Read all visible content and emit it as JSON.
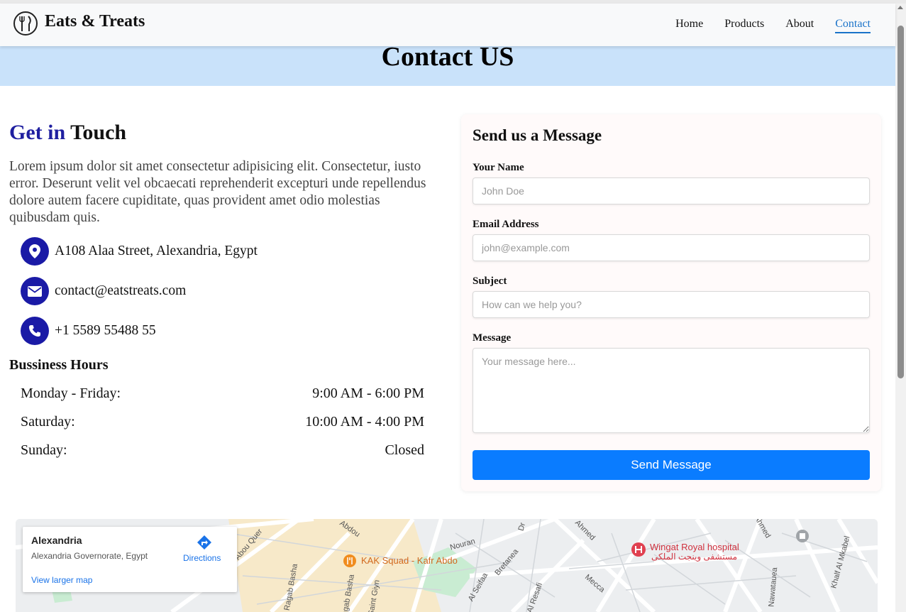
{
  "navbar": {
    "brand": "Eats & Treats",
    "links": [
      "Home",
      "Products",
      "About",
      "Contact"
    ],
    "active": "Contact"
  },
  "hero": {
    "title": "Contact US"
  },
  "touch": {
    "title_accent": "Get in",
    "title_rest": "Touch",
    "description": "Lorem ipsum dolor sit amet consectetur adipisicing elit. Consectetur, iusto error. Deserunt velit vel obcaecati reprehenderit excepturi unde repellendus dolore autem facere cupiditate, quas provident amet odio molestias quibusdam quis.",
    "address": "A108 Alaa Street, Alexandria, Egypt",
    "email": "contact@eatstreats.com",
    "phone": "+1 5589 55488 55"
  },
  "hours": {
    "title": "Bussiness Hours",
    "rows": [
      {
        "day": "Monday - Friday:",
        "time": "9:00 AM - 6:00 PM"
      },
      {
        "day": "Saturday:",
        "time": "10:00 AM - 4:00 PM"
      },
      {
        "day": "Sunday:",
        "time": "Closed"
      }
    ]
  },
  "form": {
    "title": "Send us a Message",
    "name_label": "Your Name",
    "name_placeholder": "John Doe",
    "email_label": "Email Address",
    "email_placeholder": "john@example.com",
    "subject_label": "Subject",
    "subject_placeholder": "How can we help you?",
    "message_label": "Message",
    "message_placeholder": "Your message here...",
    "submit": "Send Message"
  },
  "map": {
    "place": "Alexandria",
    "region": "Alexandria Governorate, Egypt",
    "directions": "Directions",
    "larger": "View larger map",
    "poi_restaurant": "KAK Squad - Kafr Abdo",
    "poi_hospital": "Wingat Royal hospital",
    "poi_hospital_ar": "مستشفى وينجت الملكى",
    "streets": [
      "Abdou",
      "Abou Quer",
      "Ragab Basha",
      "Ragab Basha",
      "Saint Giyn",
      "Al Seifaa",
      "Bretanea",
      "Nouran",
      "Ahmed",
      "Al Resafi",
      "Mecca",
      "Nawatauea",
      "Khalf Al Mkabel",
      "Dr",
      "Ahmed"
    ],
    "colors": {
      "accent": "#1a73e8",
      "road": "#ffffff",
      "land": "#eceef0",
      "sand": "#f7e9c9",
      "park": "#c9ecd2",
      "hospital": "#e04050",
      "food": "#f08c1e"
    }
  },
  "colors": {
    "primary_circle": "#1a1aa6",
    "button": "#0a7cff",
    "hero": "#c9e2fa",
    "active_link": "#1a73c9"
  }
}
